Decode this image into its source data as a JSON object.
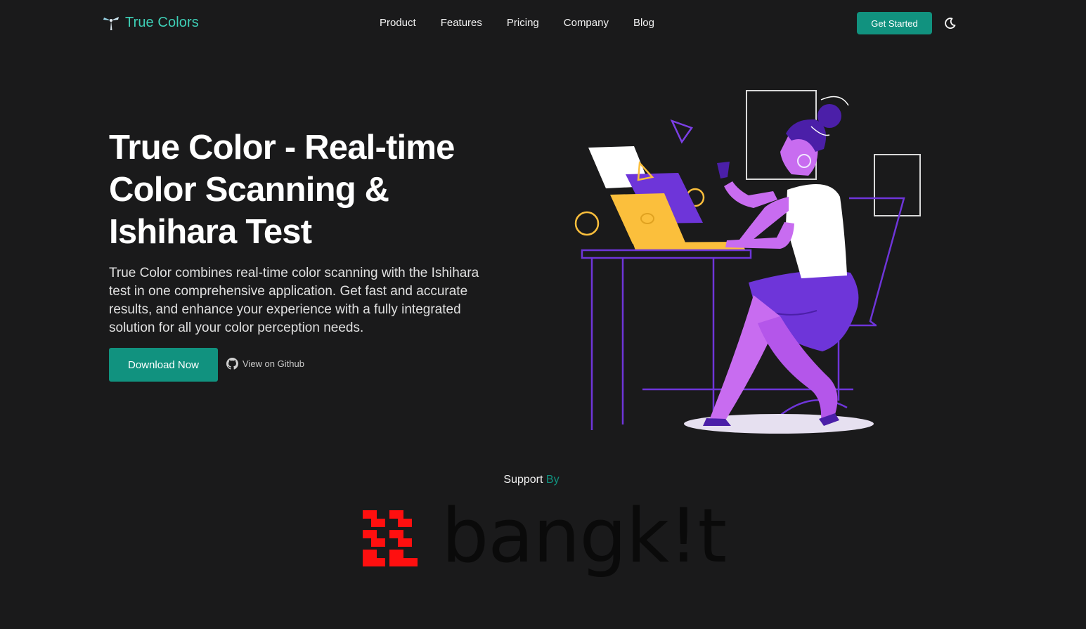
{
  "brand": {
    "name": "True Colors",
    "color": "#3ecfb6",
    "icon": "pinwheel-logo-icon"
  },
  "nav": {
    "items": [
      "Product",
      "Features",
      "Pricing",
      "Company",
      "Blog"
    ],
    "cta_label": "Get Started",
    "theme_icon": "moon-icon"
  },
  "hero": {
    "title": "True Color - Real-time Color Scanning & Ishihara Test",
    "description": "True Color combines real-time color scanning with the Ishihara test in one comprehensive application. Get fast and accurate results, and enhance your experience with a fully integrated solution for all your color perception needs.",
    "primary_button": "Download Now",
    "secondary_link": "View on Github",
    "secondary_icon": "github-icon"
  },
  "support": {
    "prefix": "Support",
    "accent": "By"
  },
  "sponsor": {
    "name": "bangk!t",
    "mark_color": "#ff0f0f"
  },
  "colors": {
    "accent": "#11927f",
    "background": "#1a1a1b",
    "illustration_purple": "#7b3fe4",
    "illustration_yellow": "#fbbf3c"
  }
}
